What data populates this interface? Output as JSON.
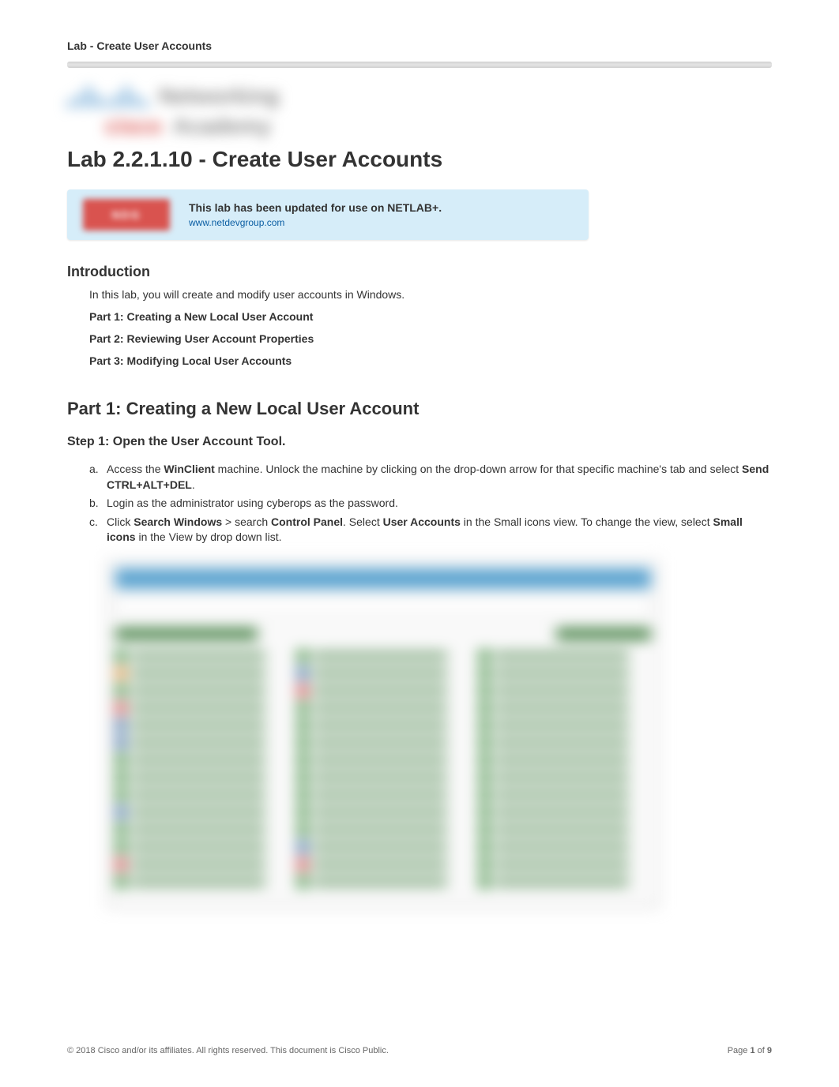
{
  "header": {
    "label": "Lab - Create User Accounts"
  },
  "logo": {
    "line1": "Networking",
    "line2a": "cisco",
    "line2b": "Academy"
  },
  "title": "Lab 2.2.1.10 - Create User Accounts",
  "banner": {
    "badge": "NDG",
    "text": "This lab has been updated for use on NETLAB+.",
    "link_text": "www.netdevgroup.com",
    "link_href": "http://www.netdevgroup.com"
  },
  "introduction": {
    "heading": "Introduction",
    "text": "In this lab, you will create and modify user accounts in Windows.",
    "parts": [
      "Part 1: Creating a New Local User Account",
      "Part 2: Reviewing User Account Properties",
      "Part 3: Modifying Local User Accounts"
    ]
  },
  "part1": {
    "heading": "Part 1: Creating a New Local User Account",
    "step1": {
      "heading": "Step 1:   Open the User Account Tool.",
      "items": {
        "a": {
          "pre": "Access  the ",
          "bold1": "WinClient",
          "mid": " machine. Unlock the machine by clicking on the drop-down arrow for that specific machine's tab and select ",
          "bold2": "Send CTRL+ALT+DEL",
          "post": "."
        },
        "b": {
          "pre": "Login  as  the ",
          "val1": "administrator",
          "mid": "     using ",
          "val2": "cyberops",
          "post": "  as the password."
        },
        "c": {
          "pre": " Click ",
          "bold1": "Search Windows",
          "mid1": " > search ",
          "bold2": "Control Panel",
          "mid2": ". Select ",
          "bold3": "User Accounts",
          "mid3": " in the Small icons view. To change the view, select ",
          "bold4": "Small icons",
          "post": " in the View by drop down list."
        }
      }
    }
  },
  "footer": {
    "copyright": "© 2018 Cisco and/or its affiliates. All rights reserved. This document is Cisco Public.",
    "page_label_pre": "Page ",
    "page_current": "1",
    "page_of": " of ",
    "page_total": "9"
  }
}
